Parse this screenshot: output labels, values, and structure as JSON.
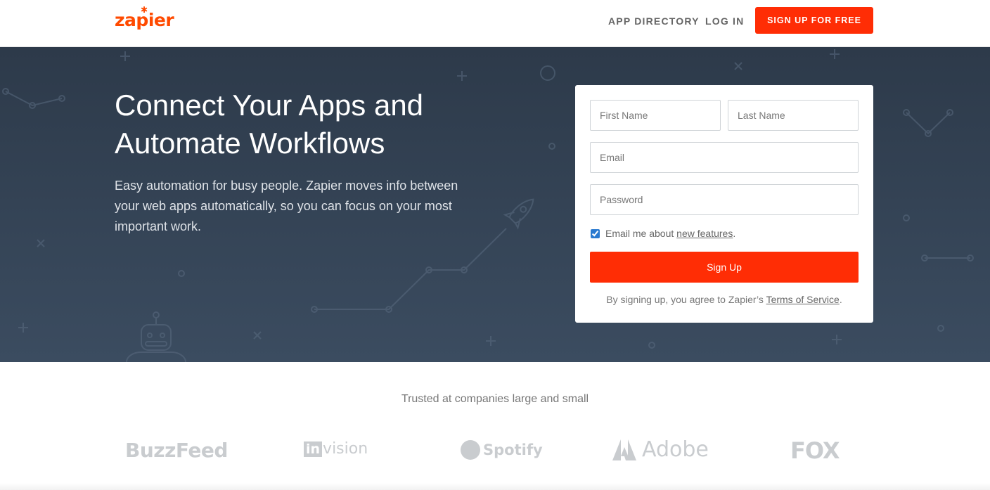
{
  "header": {
    "logo_text": "zapier",
    "nav": {
      "app_directory": "APP DIRECTORY",
      "log_in": "LOG IN",
      "signup_cta": "SIGN UP FOR FREE"
    }
  },
  "hero": {
    "headline": "Connect Your Apps and Automate Workflows",
    "subtext": "Easy automation for busy people. Zapier moves info between your web apps automatically, so you can focus on your most important work."
  },
  "form": {
    "first_name_placeholder": "First Name",
    "last_name_placeholder": "Last Name",
    "email_placeholder": "Email",
    "password_placeholder": "Password",
    "email_optin_checked": true,
    "email_optin_prefix": "Email me about ",
    "email_optin_link": "new features",
    "email_optin_suffix": ".",
    "submit_label": "Sign Up",
    "terms_prefix": "By signing up, you agree to Zapier’s ",
    "terms_link": "Terms of Service",
    "terms_suffix": "."
  },
  "trusted": {
    "heading": "Trusted at companies large and small",
    "logos": {
      "buzzfeed": "BuzzFeed",
      "invision_in": "in",
      "invision_rest": "vision",
      "spotify": "Spotify",
      "adobe": "Adobe",
      "fox": "FOX"
    }
  },
  "colors": {
    "brand_orange": "#ff4a00",
    "cta_red": "#ff2d05",
    "hero_bg": "#2d3a4a"
  },
  "icons": {
    "hero_decoration": [
      "rocket-icon",
      "robot-icon",
      "plus-icon",
      "cross-icon",
      "circle-icon"
    ]
  }
}
